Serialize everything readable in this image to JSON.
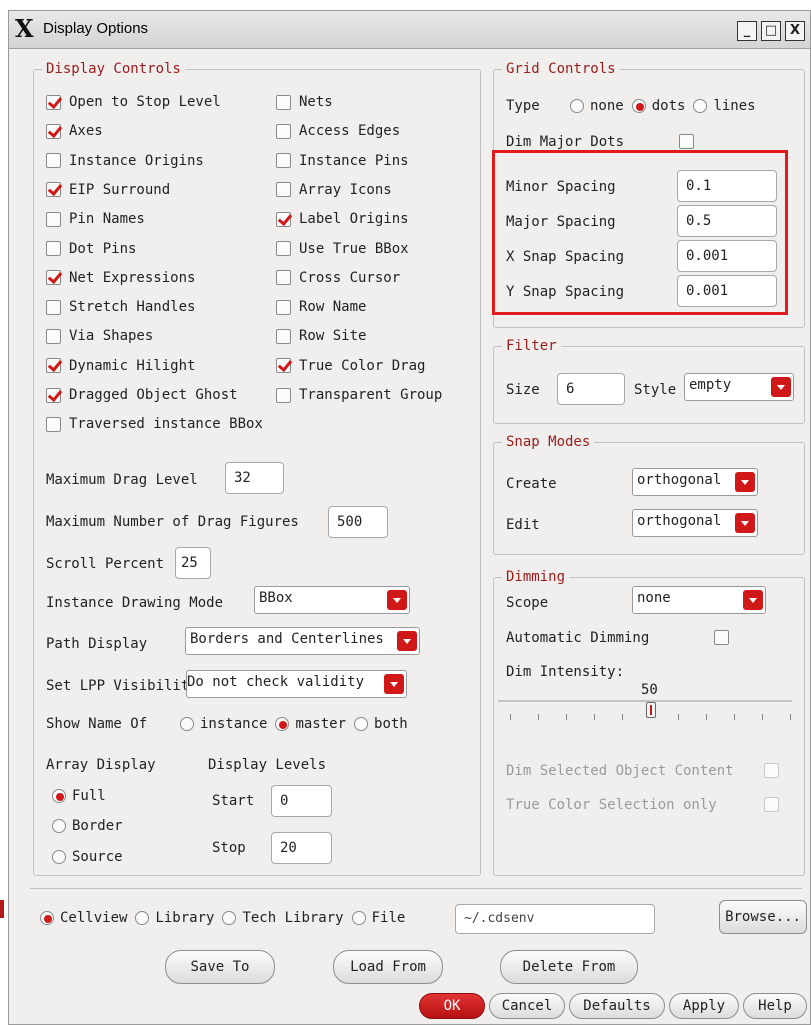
{
  "window": {
    "title": "Display Options",
    "buttons": {
      "minimize": "_",
      "maximize": "□",
      "close": "X"
    }
  },
  "display_controls": {
    "legend": "Display Controls",
    "col1": [
      {
        "label": "Open to Stop Level",
        "checked": true
      },
      {
        "label": "Axes",
        "checked": true
      },
      {
        "label": "Instance Origins",
        "checked": false
      },
      {
        "label": "EIP Surround",
        "checked": true
      },
      {
        "label": "Pin Names",
        "checked": false
      },
      {
        "label": "Dot Pins",
        "checked": false
      },
      {
        "label": "Net Expressions",
        "checked": true
      },
      {
        "label": "Stretch Handles",
        "checked": false
      },
      {
        "label": "Via Shapes",
        "checked": false
      },
      {
        "label": "Dynamic Hilight",
        "checked": true
      },
      {
        "label": "Dragged Object Ghost",
        "checked": true
      },
      {
        "label": "Traversed instance BBox",
        "checked": false
      }
    ],
    "col2": [
      {
        "label": "Nets",
        "checked": false
      },
      {
        "label": "Access Edges",
        "checked": false
      },
      {
        "label": "Instance Pins",
        "checked": false
      },
      {
        "label": "Array Icons",
        "checked": false
      },
      {
        "label": "Label Origins",
        "checked": true
      },
      {
        "label": "Use True BBox",
        "checked": false
      },
      {
        "label": "Cross Cursor",
        "checked": false
      },
      {
        "label": "Row Name",
        "checked": false
      },
      {
        "label": "Row Site",
        "checked": false
      },
      {
        "label": "True Color Drag",
        "checked": true
      },
      {
        "label": "Transparent Group",
        "checked": false
      }
    ],
    "max_drag_level": {
      "label": "Maximum Drag Level",
      "value": "32"
    },
    "max_drag_figures": {
      "label": "Maximum Number of Drag Figures",
      "value": "500"
    },
    "scroll_percent": {
      "label": "Scroll Percent",
      "value": "25"
    },
    "instance_drawing_mode": {
      "label": "Instance Drawing Mode",
      "value": "BBox"
    },
    "path_display": {
      "label": "Path Display",
      "value": "Borders and Centerlines"
    },
    "lpp_visibility": {
      "label": "Set LPP Visibilit",
      "value": "Do not check validity"
    },
    "show_name_of": {
      "label": "Show Name Of",
      "options": [
        "instance",
        "master",
        "both"
      ],
      "selected": "master"
    },
    "array_display": {
      "label": "Array Display",
      "options": [
        "Full",
        "Border",
        "Source"
      ],
      "selected": "Full"
    },
    "display_levels": {
      "label": "Display Levels",
      "start_label": "Start",
      "start": "0",
      "stop_label": "Stop",
      "stop": "20"
    }
  },
  "grid_controls": {
    "legend": "Grid Controls",
    "type": {
      "label": "Type",
      "options": [
        "none",
        "dots",
        "lines"
      ],
      "selected": "dots"
    },
    "dim_major_dots": {
      "label": "Dim Major Dots",
      "checked": false
    },
    "minor_spacing": {
      "label": "Minor Spacing",
      "value": "0.1"
    },
    "major_spacing": {
      "label": "Major Spacing",
      "value": "0.5"
    },
    "x_snap": {
      "label": "X Snap Spacing",
      "value": "0.001"
    },
    "y_snap": {
      "label": "Y Snap Spacing",
      "value": "0.001"
    }
  },
  "filter": {
    "legend": "Filter",
    "size_label": "Size",
    "size": "6",
    "style_label": "Style",
    "style": "empty"
  },
  "snap_modes": {
    "legend": "Snap Modes",
    "create_label": "Create",
    "create": "orthogonal",
    "edit_label": "Edit",
    "edit": "orthogonal"
  },
  "dimming": {
    "legend": "Dimming",
    "scope_label": "Scope",
    "scope": "none",
    "automatic_label": "Automatic Dimming",
    "automatic": false,
    "intensity_label": "Dim Intensity:",
    "intensity": "50",
    "dim_selected_label": "Dim Selected Object Content",
    "true_color_label": "True Color Selection only"
  },
  "source": {
    "options": [
      "Cellview",
      "Library",
      "Tech Library",
      "File"
    ],
    "selected": "Cellview",
    "path": "~/.cdsenv",
    "browse": "Browse..."
  },
  "actions": {
    "save_to": "Save To",
    "load_from": "Load From",
    "delete_from": "Delete From",
    "ok": "OK",
    "cancel": "Cancel",
    "defaults": "Defaults",
    "apply": "Apply",
    "help": "Help"
  },
  "colors": {
    "accent": "#d01818",
    "legend": "#9b1a1a",
    "highlight": "#e01b1b"
  }
}
